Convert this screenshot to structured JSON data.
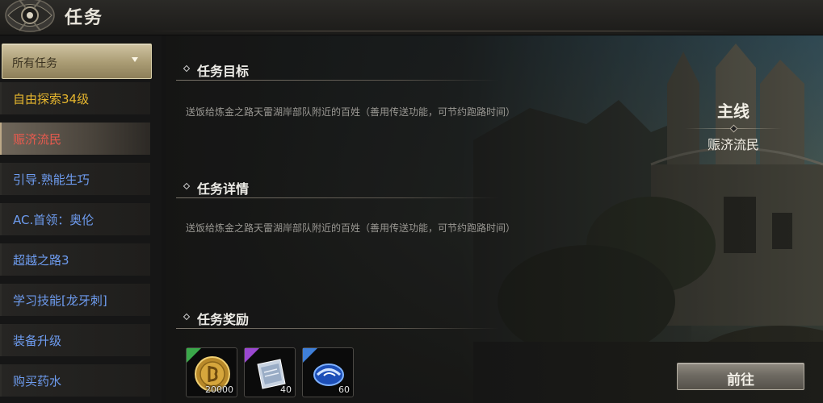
{
  "window": {
    "title": "任务"
  },
  "sidebar": {
    "filter_label": "所有任务",
    "items": [
      {
        "label": "自由探索34级",
        "style": "yellow"
      },
      {
        "label": "赈济流民",
        "style": "selected"
      },
      {
        "label": "引导.熟能生巧",
        "style": "blue"
      },
      {
        "label": "AC.首领：奥伦",
        "style": "blue"
      },
      {
        "label": "超越之路3",
        "style": "blue"
      },
      {
        "label": "学习技能[龙牙刺]",
        "style": "blue"
      },
      {
        "label": "装备升级",
        "style": "blue"
      },
      {
        "label": "购买药水",
        "style": "blue"
      }
    ]
  },
  "main": {
    "objective": {
      "title": "任务目标",
      "text": "送饭给炼金之路天雷湖岸部队附近的百姓（善用传送功能，可节约跑路时间）"
    },
    "details": {
      "title": "任务详情",
      "text": "送饭给炼金之路天雷湖岸部队附近的百姓（善用传送功能，可节约跑路时间）"
    },
    "rewards": {
      "title": "任务奖励",
      "items": [
        {
          "icon": "gold-coin-icon",
          "count": "20000",
          "rarity_color": "#3aa84a"
        },
        {
          "icon": "scroll-icon",
          "count": "40",
          "rarity_color": "#9a48d0"
        },
        {
          "icon": "blue-gem-icon",
          "count": "60",
          "rarity_color": "#3f7fd8"
        }
      ]
    },
    "quest_type": "主线",
    "quest_name": "赈济流民",
    "go_button": "前往"
  },
  "colors": {
    "yellow_text": "#e6b62e",
    "blue_text": "#6e9cf0",
    "selected_text": "#e85a4e"
  }
}
